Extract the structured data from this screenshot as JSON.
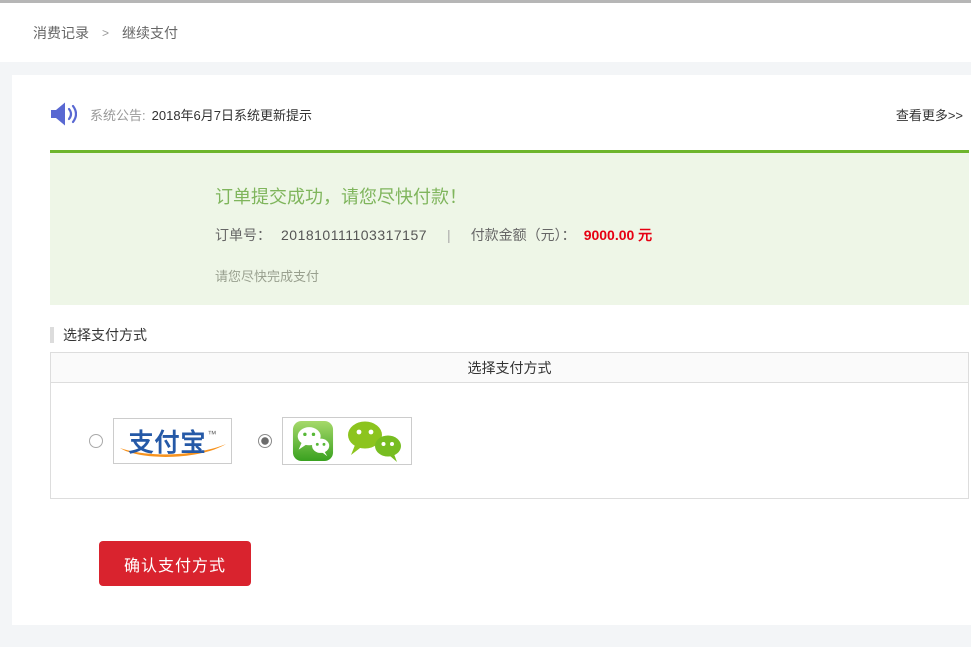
{
  "breadcrumb": {
    "items": [
      "消费记录",
      "继续支付"
    ],
    "separator": ">"
  },
  "announcement": {
    "label": "系统公告:",
    "text": "2018年6月7日系统更新提示",
    "more_link": "查看更多>>"
  },
  "order_banner": {
    "title": "订单提交成功，请您尽快付款！",
    "order_label": "订单号：",
    "order_number": "201810111103317157",
    "divider": "|",
    "amount_label": "付款金额（元）：",
    "amount_value": "9000.00 元",
    "note": "请您尽快完成支付"
  },
  "payment_section": {
    "heading": "选择支付方式",
    "table_header": "选择支付方式",
    "methods": [
      {
        "id": "alipay",
        "icon": "alipay-logo-icon",
        "logo_text": "支付宝",
        "trademark": "™",
        "selected": false
      },
      {
        "id": "wechat",
        "icon": "wechat-bubbles-icon",
        "selected": true
      }
    ]
  },
  "confirm_button_label": "确认支付方式",
  "icons": {
    "announcement": "megaphone-icon",
    "alipay": "alipay-logo-icon",
    "wechat_app": "wechat-app-icon",
    "wechat_logo": "wechat-bubbles-icon"
  },
  "colors": {
    "banner_border_green": "#6db52c",
    "banner_bg_green": "#eef6e7",
    "banner_title_green": "#7fb55c",
    "amount_red": "#e60012",
    "button_red": "#d9232e",
    "megaphone_blue": "#5968d2",
    "alipay_blue": "#2559a7",
    "alipay_orange": "#f7931e",
    "wechat_green": "#57b837",
    "page_gray": "#f3f5f7"
  }
}
